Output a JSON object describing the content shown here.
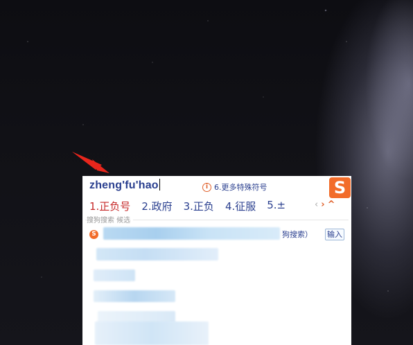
{
  "ime": {
    "pinyin": "zheng'fu'hao",
    "hint_number": "6.",
    "hint_text": "更多特殊符号",
    "logo_letter": "S",
    "candidates": [
      "1.正负号",
      "2.政府",
      "3.正负",
      "4.征服",
      "5.±"
    ],
    "nav": {
      "prev": "‹",
      "next": "›",
      "collapse": "^"
    },
    "search_label": "搜狗搜索 候选",
    "search_icon_letter": "S",
    "search_suffix": "狗搜索）",
    "input_button": "输入"
  },
  "colors": {
    "pinyin": "#2a3f8f",
    "first_candidate": "#c62828",
    "candidate": "#2a3f8f",
    "logo": "#f26c2a",
    "arrow": "#e8261c"
  },
  "icons": [
    "info-icon",
    "sogou-logo-icon",
    "sogou-search-icon",
    "chevron-left-icon",
    "chevron-right-icon",
    "chevron-up-icon"
  ]
}
